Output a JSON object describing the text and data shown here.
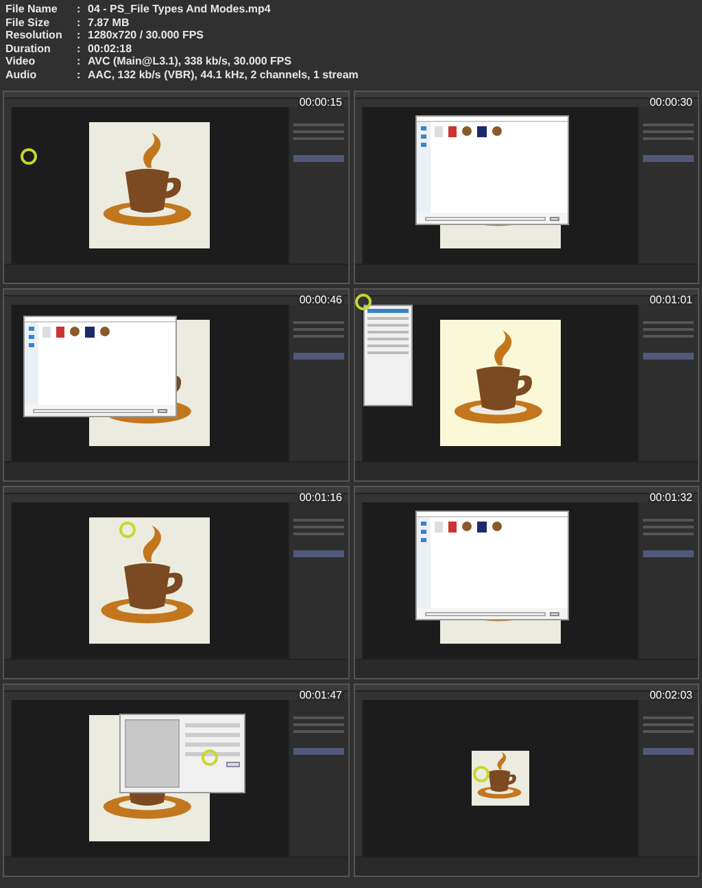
{
  "file_info": [
    {
      "label": "File Name",
      "value": "04 - PS_File Types And Modes.mp4"
    },
    {
      "label": "File Size",
      "value": "7.87 MB"
    },
    {
      "label": "Resolution",
      "value": "1280x720 / 30.000 FPS"
    },
    {
      "label": "Duration",
      "value": "00:02:18"
    },
    {
      "label": "Video",
      "value": "AVC (Main@L3.1), 338 kb/s, 30.000 FPS"
    },
    {
      "label": "Audio",
      "value": "AAC, 132 kb/s (VBR), 44.1 kHz, 2 channels, 1 stream"
    }
  ],
  "separator": ":",
  "frames": [
    {
      "timestamp": "00:00:15",
      "kind": "cup"
    },
    {
      "timestamp": "00:00:30",
      "kind": "open-dialog"
    },
    {
      "timestamp": "00:00:46",
      "kind": "open-dialog-left"
    },
    {
      "timestamp": "00:01:01",
      "kind": "menu"
    },
    {
      "timestamp": "00:01:16",
      "kind": "cup-zoom"
    },
    {
      "timestamp": "00:01:32",
      "kind": "open-dialog"
    },
    {
      "timestamp": "00:01:47",
      "kind": "save-dialog"
    },
    {
      "timestamp": "00:02:03",
      "kind": "small-cup"
    }
  ]
}
